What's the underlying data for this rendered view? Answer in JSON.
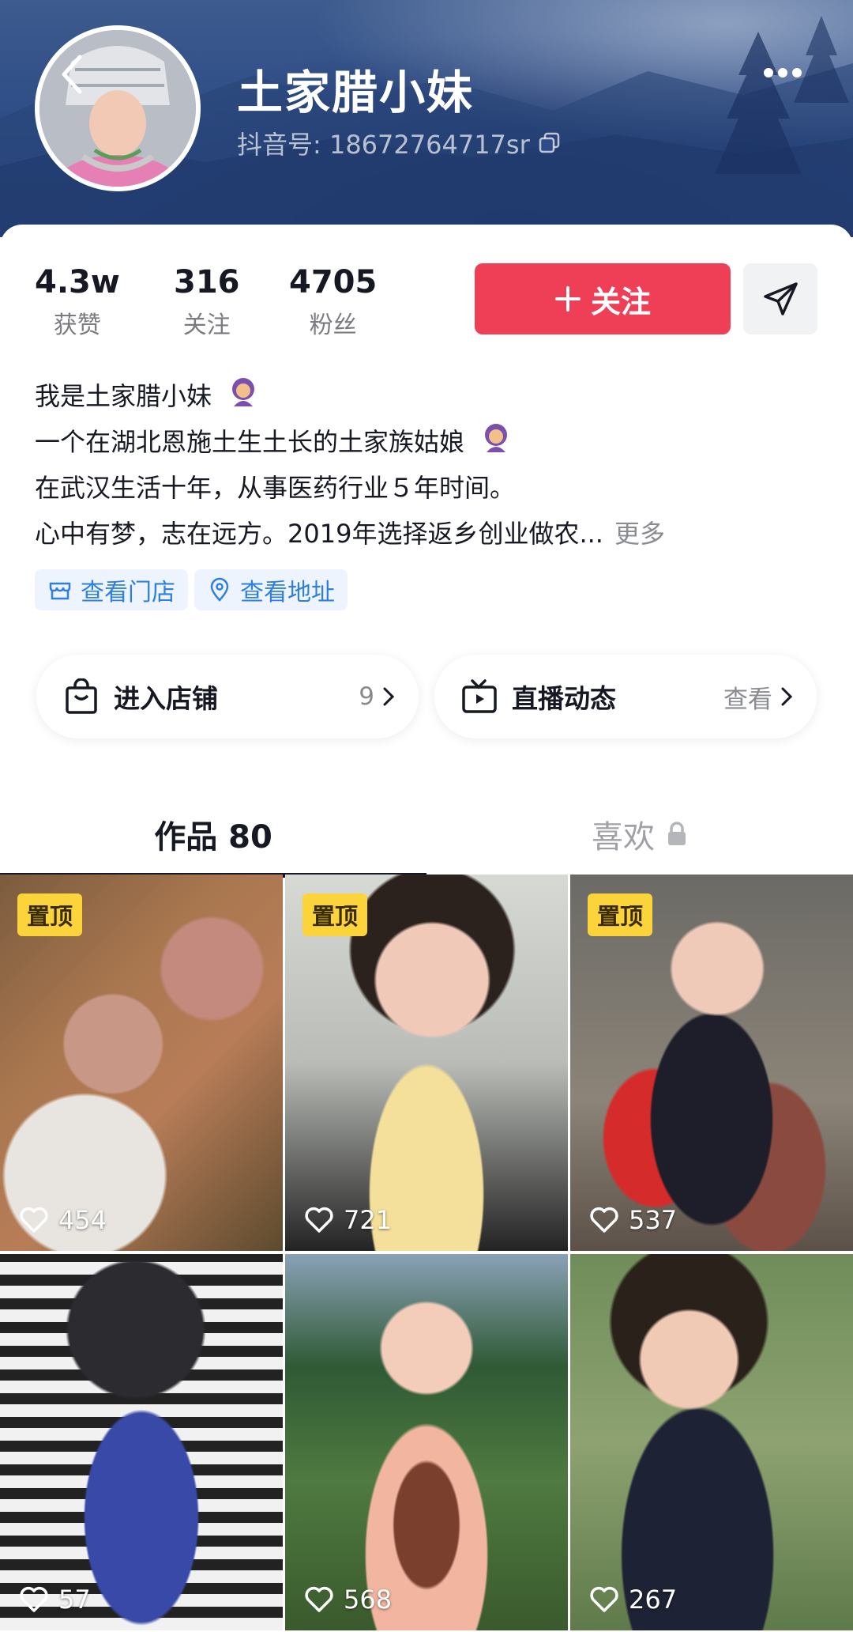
{
  "header": {
    "name": "土家腊小妹",
    "douyin_id": "抖音号: 18672764717sr"
  },
  "stats": [
    {
      "value": "4.3w",
      "label": "获赞"
    },
    {
      "value": "316",
      "label": "关注"
    },
    {
      "value": "4705",
      "label": "粉丝"
    }
  ],
  "actions": {
    "follow_label": "关注",
    "follow_color": "#ee3f57"
  },
  "bio": {
    "line1": "我是土家腊小妹",
    "line2": "一个在湖北恩施土生土长的土家族姑娘",
    "line3": "在武汉生活十年，从事医药行业５年时间。",
    "line4": "心中有梦，志在远方。2019年选择返乡创业做农...",
    "more": "更多"
  },
  "chips": {
    "store": "查看门店",
    "address": "查看地址"
  },
  "cards": {
    "shop_label": "进入店铺",
    "shop_count": "9",
    "live_label": "直播动态",
    "live_action": "查看"
  },
  "tabs": {
    "works": "作品 80",
    "likes": "喜欢"
  },
  "videos": [
    {
      "pinned": "置顶",
      "likes": "454"
    },
    {
      "pinned": "置顶",
      "likes": "721"
    },
    {
      "pinned": "置顶",
      "likes": "537"
    },
    {
      "pinned": "",
      "likes": "57"
    },
    {
      "pinned": "",
      "likes": "568"
    },
    {
      "pinned": "",
      "likes": "267"
    }
  ]
}
